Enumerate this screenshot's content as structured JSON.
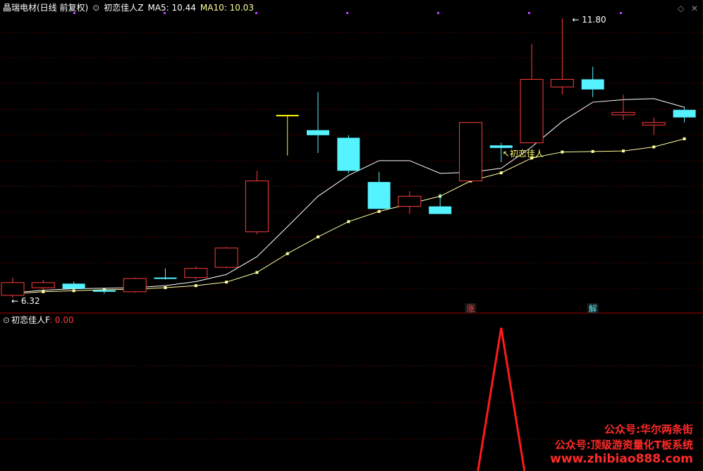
{
  "header": {
    "stock_name": "晶瑞电材(日线 前复权)",
    "indicator_name": "初恋佳人Z",
    "ma5_label": "MA5: 10.44",
    "ma10_label": "MA10: 10.03"
  },
  "lower_header": {
    "indicator_name": "初恋佳人F",
    "value_label": ": 0.00"
  },
  "markers": {
    "up_label": "涨",
    "release_label": "解"
  },
  "watermark": {
    "line1": "公众号:华尔两条街",
    "line2": "公众号:顶级游资量化T板系统",
    "line3": "www.zhibiao888.com"
  },
  "controls": {
    "diamond_icon": "diamond-icon",
    "close_icon": "close-icon"
  },
  "colors": {
    "up": "#ff3b3b",
    "down": "#55f2ff",
    "flat": "#ffff00",
    "ma5": "#ffffff",
    "ma10": "#ffffa0",
    "grid": "#5a0000",
    "signal": "#ff1a1a"
  },
  "chart_data": [
    {
      "type": "candlestick",
      "title": "晶瑞电材(日线 前复权)",
      "ylim": [
        6.0,
        12.0
      ],
      "low_label": "6.32",
      "high_label": "11.80",
      "signal_label": "初恋佳人",
      "candles": [
        {
          "o": 6.35,
          "h": 6.7,
          "l": 6.3,
          "c": 6.6
        },
        {
          "o": 6.5,
          "h": 6.65,
          "l": 6.45,
          "c": 6.6
        },
        {
          "o": 6.58,
          "h": 6.62,
          "l": 6.45,
          "c": 6.48
        },
        {
          "o": 6.45,
          "h": 6.48,
          "l": 6.38,
          "c": 6.42
        },
        {
          "o": 6.42,
          "h": 6.7,
          "l": 6.4,
          "c": 6.68
        },
        {
          "o": 6.7,
          "h": 6.88,
          "l": 6.66,
          "c": 6.68
        },
        {
          "o": 6.7,
          "h": 6.92,
          "l": 6.66,
          "c": 6.88
        },
        {
          "o": 6.9,
          "h": 7.3,
          "l": 6.88,
          "c": 7.28
        },
        {
          "o": 7.6,
          "h": 8.8,
          "l": 7.55,
          "c": 8.6
        },
        {
          "o": 9.9,
          "h": 9.9,
          "l": 9.1,
          "c": 9.9
        },
        {
          "o": 9.6,
          "h": 10.35,
          "l": 9.15,
          "c": 9.5
        },
        {
          "o": 9.45,
          "h": 9.5,
          "l": 8.75,
          "c": 8.8
        },
        {
          "o": 8.58,
          "h": 8.78,
          "l": 8.1,
          "c": 8.05
        },
        {
          "o": 8.1,
          "h": 8.4,
          "l": 7.95,
          "c": 8.3
        },
        {
          "o": 8.1,
          "h": 8.35,
          "l": 8.0,
          "c": 7.95
        },
        {
          "o": 8.6,
          "h": 9.75,
          "l": 8.6,
          "c": 9.75
        },
        {
          "o": 9.3,
          "h": 9.35,
          "l": 8.97,
          "c": 9.25
        },
        {
          "o": 9.35,
          "h": 11.3,
          "l": 9.35,
          "c": 10.6
        },
        {
          "o": 10.45,
          "h": 11.8,
          "l": 10.3,
          "c": 10.6
        },
        {
          "o": 10.6,
          "h": 10.85,
          "l": 10.25,
          "c": 10.4
        },
        {
          "o": 9.9,
          "h": 10.3,
          "l": 9.8,
          "c": 9.95
        },
        {
          "o": 9.7,
          "h": 9.85,
          "l": 9.5,
          "c": 9.75
        },
        {
          "o": 10.0,
          "h": 10.05,
          "l": 9.75,
          "c": 9.85
        }
      ],
      "ma5": [
        6.4,
        6.45,
        6.48,
        6.49,
        6.5,
        6.54,
        6.62,
        6.76,
        7.11,
        7.7,
        8.3,
        8.71,
        9.0,
        9.0,
        8.75,
        8.77,
        8.85,
        9.27,
        9.77,
        10.15,
        10.2,
        10.22,
        10.05
      ],
      "ma10": [
        6.38,
        6.42,
        6.44,
        6.46,
        6.47,
        6.5,
        6.54,
        6.61,
        6.8,
        7.17,
        7.5,
        7.8,
        8.0,
        8.15,
        8.3,
        8.6,
        8.76,
        9.05,
        9.17,
        9.18,
        9.19,
        9.27,
        9.43
      ],
      "up_marker_index": 15,
      "release_marker_index": 19
    },
    {
      "type": "line",
      "title": "初恋佳人F",
      "ylim": [
        0,
        1
      ],
      "signal_index": 16,
      "values": [
        0,
        0,
        0,
        0,
        0,
        0,
        0,
        0,
        0,
        0,
        0,
        0,
        0,
        0,
        0,
        0,
        1,
        0,
        0,
        0,
        0,
        0,
        0
      ]
    }
  ]
}
